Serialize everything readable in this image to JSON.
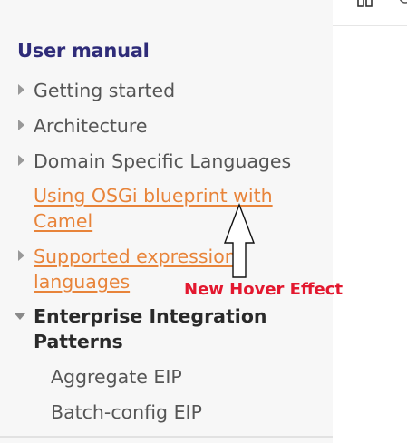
{
  "sidebar": {
    "heading": "User manual",
    "items": [
      {
        "label": "Getting started",
        "expandable": true
      },
      {
        "label": "Architecture",
        "expandable": true
      },
      {
        "label": "Domain Specific Languages",
        "expandable": true
      },
      {
        "label_line1": "Using OSGi blueprint with",
        "label_line2": "Camel",
        "hovered": true
      },
      {
        "label_line1": "Supported expression",
        "label_line2": "languages",
        "hovered": true,
        "expandable": true
      },
      {
        "label_line1": "Enterprise Integration",
        "label_line2": "Patterns",
        "expanded": true
      },
      {
        "label": "Aggregate EIP",
        "child": true
      },
      {
        "label": "Batch-config EIP",
        "child": true
      }
    ]
  },
  "annotation": {
    "text": "New Hover Effect"
  },
  "colors": {
    "heading": "#2f2c79",
    "hover_link": "#e8843a",
    "annotation": "#e3182f"
  },
  "icons": [
    "grid-icon",
    "caret-right-icon",
    "caret-down-icon",
    "up-arrow-icon"
  ]
}
